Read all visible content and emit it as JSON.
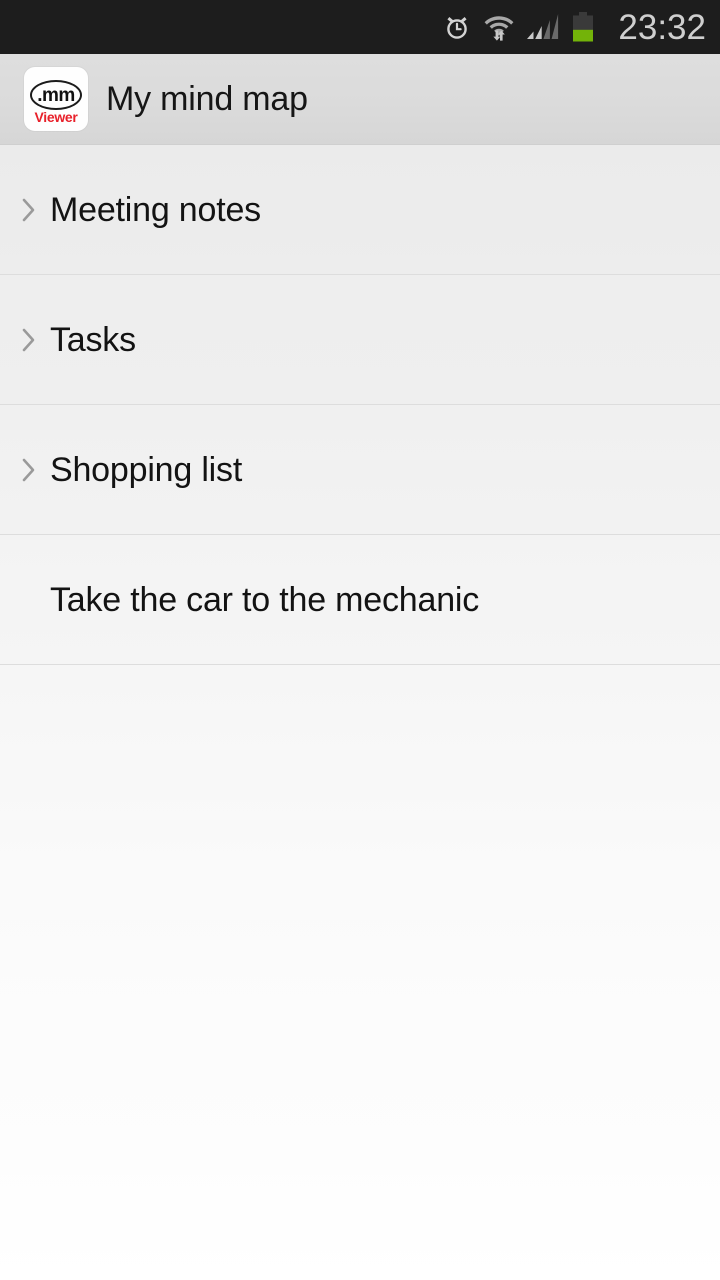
{
  "status_bar": {
    "time": "23:32",
    "background": "#1d1d1d",
    "text_color": "#cfcfcf",
    "icons": [
      {
        "name": "alarm-clock-icon",
        "label": "Alarm set"
      },
      {
        "name": "wifi-transfer-icon",
        "label": "Wi-Fi connected with data transfer"
      },
      {
        "name": "cellular-signal-icon",
        "label": "Cellular signal 2 of 4 bars"
      },
      {
        "name": "battery-icon",
        "label": "Battery 45%",
        "fill_color": "#73b309",
        "fill_percent": 45
      }
    ]
  },
  "action_bar": {
    "title": "My mind map",
    "app_icon": {
      "name": "mm-viewer-app-icon",
      "monogram": ".mm",
      "subtitle": "Viewer",
      "subtitle_color": "#e8202a",
      "background": "#fefefe"
    },
    "background": "#dedede"
  },
  "list": {
    "items": [
      {
        "label": "Meeting notes",
        "expandable": true,
        "chevron": "chevron-right-icon"
      },
      {
        "label": "Tasks",
        "expandable": true,
        "chevron": "chevron-right-icon"
      },
      {
        "label": "Shopping list",
        "expandable": true,
        "chevron": "chevron-right-icon"
      },
      {
        "label": "Take the car to the mechanic",
        "expandable": false,
        "chevron": ""
      }
    ],
    "divider_color": "#dddddd",
    "text_color": "#131313"
  }
}
